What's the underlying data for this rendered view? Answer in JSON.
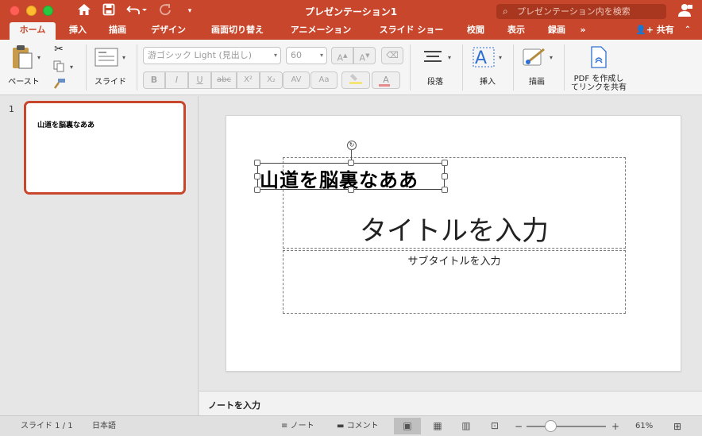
{
  "window": {
    "title": "プレゼンテーション1",
    "search_placeholder": "プレゼンテーション内を検索"
  },
  "tabs": [
    {
      "label": "ホーム",
      "active": true
    },
    {
      "label": "挿入"
    },
    {
      "label": "描画"
    },
    {
      "label": "デザイン"
    },
    {
      "label": "画面切り替え"
    },
    {
      "label": "アニメーション"
    },
    {
      "label": "スライド ショー"
    },
    {
      "label": "校閲"
    },
    {
      "label": "表示"
    },
    {
      "label": "録画"
    }
  ],
  "tabs_more": "»",
  "share_label": "共有",
  "ribbon": {
    "paste_label": "ペースト",
    "slide_label": "スライド",
    "font_name": "游ゴシック Light (見出し)",
    "font_size": "60",
    "paragraph_label": "段落",
    "insert_label": "挿入",
    "draw_label": "描画",
    "pdf_label_line1": "PDF を作成し",
    "pdf_label_line2": "てリンクを共有",
    "format_buttons": {
      "bold": "B",
      "italic": "I",
      "underline": "U",
      "strike": "abc",
      "superscript": "X²",
      "subscript": "X₂",
      "spacing": "AV",
      "case": "Aa"
    }
  },
  "thumbnails": [
    {
      "number": "1",
      "text": "山道を脳裏なああ"
    }
  ],
  "slide": {
    "selected_text": "山道を脳裏なああ",
    "title_placeholder": "タイトルを入力",
    "subtitle_placeholder": "サブタイトルを入力"
  },
  "notes_placeholder": "ノートを入力",
  "statusbar": {
    "slide_counter": "スライド 1 / 1",
    "language": "日本語",
    "notes": "ノート",
    "comments": "コメント",
    "zoom": "61%",
    "zoom_level": 0.61
  },
  "colors": {
    "accent": "#c8472c",
    "title_bar": "#c8472c"
  }
}
